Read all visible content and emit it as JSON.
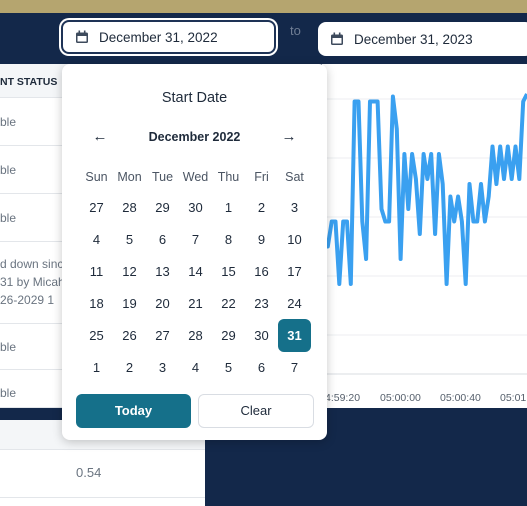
{
  "filters": {
    "start_date": "December 31, 2022",
    "separator": "to",
    "end_date": "December 31, 2023"
  },
  "table": {
    "header": "NT STATUS",
    "rows": [
      {
        "lines": [
          "ble"
        ]
      },
      {
        "lines": [
          "ble"
        ]
      },
      {
        "lines": [
          "ble"
        ]
      },
      {
        "lines": [
          "d down sinc",
          "31 by Micah",
          "26-2029 1"
        ]
      },
      {
        "lines": [
          "ble"
        ]
      },
      {
        "lines": [
          "ble"
        ]
      }
    ]
  },
  "lower_table": {
    "value": "0.54"
  },
  "calendar": {
    "title": "Start Date",
    "month_label": "December 2022",
    "prev_icon": "arrow-left-icon",
    "next_icon": "arrow-right-icon",
    "weekdays": [
      "Sun",
      "Mon",
      "Tue",
      "Wed",
      "Thu",
      "Fri",
      "Sat"
    ],
    "weeks": [
      [
        "27",
        "28",
        "29",
        "30",
        "1",
        "2",
        "3"
      ],
      [
        "4",
        "5",
        "6",
        "7",
        "8",
        "9",
        "10"
      ],
      [
        "11",
        "12",
        "13",
        "14",
        "15",
        "16",
        "17"
      ],
      [
        "18",
        "19",
        "20",
        "21",
        "22",
        "23",
        "24"
      ],
      [
        "25",
        "26",
        "27",
        "28",
        "29",
        "30",
        "31"
      ],
      [
        "1",
        "2",
        "3",
        "4",
        "5",
        "6",
        "7"
      ]
    ],
    "selected_day": "31",
    "today_label": "Today",
    "clear_label": "Clear"
  },
  "chart": {
    "x_ticks": [
      "4:59:20",
      "05:00:00",
      "05:00:40",
      "05:01:"
    ],
    "line_color": "#3aa0f0",
    "series": [
      0.35,
      0.35,
      0.45,
      0.45,
      0.2,
      0.45,
      0.45,
      0.2,
      0.93,
      0.93,
      0.45,
      0.3,
      0.93,
      0.93,
      0.93,
      0.5,
      0.45,
      0.45,
      0.95,
      0.82,
      0.3,
      0.72,
      0.5,
      0.72,
      0.62,
      0.4,
      0.72,
      0.62,
      0.72,
      0.4,
      0.72,
      0.6,
      0.2,
      0.55,
      0.45,
      0.55,
      0.45,
      0.2,
      0.6,
      0.45,
      0.45,
      0.6,
      0.45,
      0.55,
      0.75,
      0.6,
      0.75,
      0.62,
      0.75,
      0.62,
      0.75,
      0.62,
      0.93,
      0.96
    ]
  }
}
